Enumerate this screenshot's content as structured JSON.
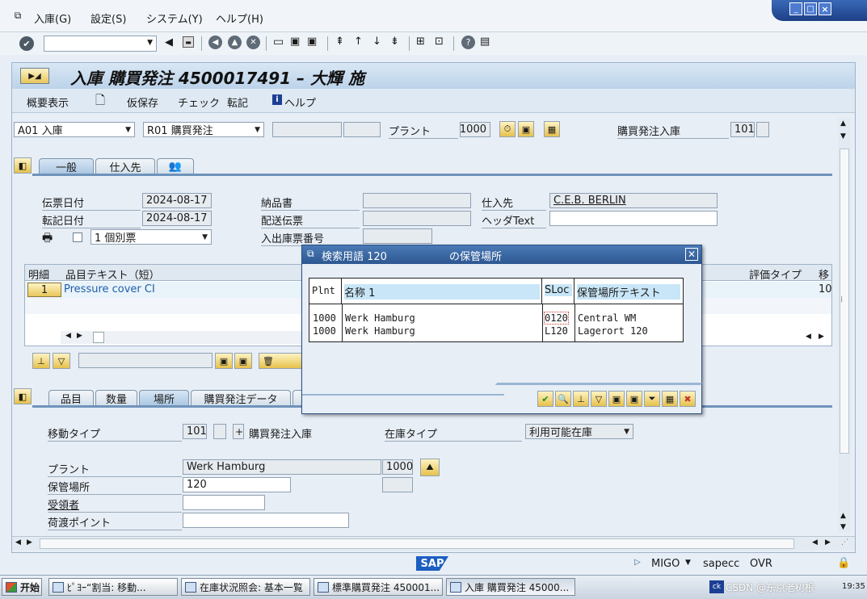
{
  "menubar": {
    "items": [
      "入庫(G)",
      "設定(S)",
      "システム(Y)",
      "ヘルプ(H)"
    ]
  },
  "window_controls": [
    "_",
    "□",
    "×"
  ],
  "header": {
    "title": "入庫 購買発注 4500017491 – 大輝 施"
  },
  "app_toolbar": {
    "overview": "概要表示",
    "hold": "仮保存",
    "check": "チェック",
    "post": "転記",
    "help": "ヘルプ"
  },
  "selection_row": {
    "action": "A01 入庫",
    "ref_doc": "R01 購買発注",
    "plant_label": "プラント",
    "plant_value": "1000",
    "movement_label": "購買発注入庫",
    "movement_value": "101"
  },
  "header_tabs": [
    "一般",
    "仕入先"
  ],
  "general": {
    "doc_date_label": "伝票日付",
    "doc_date": "2024-08-17",
    "post_date_label": "転記日付",
    "post_date": "2024-08-17",
    "slip_select": "1 個別票",
    "delivery_note_label": "納品書",
    "bill_of_lading_label": "配送伝票",
    "goods_slip_label": "入出庫票番号",
    "vendor_label": "仕入先",
    "vendor_value": "C.E.B. BERLIN",
    "header_text_label": "ヘッダText"
  },
  "items_table": {
    "headers": [
      "明細",
      "品目テキスト（短）"
    ],
    "right_headers": [
      "評価タイプ",
      "移"
    ],
    "rows": [
      {
        "line": "1",
        "text": "Pressure cover CI",
        "right": "10"
      }
    ]
  },
  "item_tabs": [
    "品目",
    "数量",
    "場所",
    "購買発注データ"
  ],
  "location": {
    "movement_type_label": "移動タイプ",
    "movement_type": "101",
    "plus": "+",
    "movement_text": "購買発注入庫",
    "stock_type_label": "在庫タイプ",
    "stock_type": "利用可能在庫",
    "plant_label": "プラント",
    "plant_name": "Werk Hamburg",
    "plant_code": "1000",
    "sloc_label": "保管場所",
    "sloc_value": "120",
    "recipient_label": "受領者",
    "unloading_label": "荷渡ポイント"
  },
  "popup": {
    "title": "検索用語 120",
    "title2": "の保管場所",
    "columns": [
      "Plnt",
      "名称 1",
      "SLoc",
      "保管場所テキスト"
    ],
    "rows": [
      {
        "plnt": "1000",
        "name": "Werk Hamburg",
        "sloc": "0120",
        "text": "Central WM"
      },
      {
        "plnt": "1000",
        "name": "Werk Hamburg",
        "sloc": "L120",
        "text": "Lagerort 120"
      }
    ]
  },
  "statusbar": {
    "logo": "SAP",
    "tcode": "MIGO",
    "server": "sapecc",
    "mode": "OVR"
  },
  "taskbar": {
    "start": "开始",
    "tasks": [
      "ﾋﾟﾖｰ“割当: 移動...",
      "在庫状況照会: 基本一覧",
      "標準購買発注 450001...",
      "入庫 購買発注 45000..."
    ],
    "tray_time": "19:35",
    "watermark": "CSDN @东京老树根"
  },
  "colors": {
    "title_band": "#c9dcef",
    "popup_title": "#2f5f9a",
    "table_header": "#c8e6f7"
  }
}
